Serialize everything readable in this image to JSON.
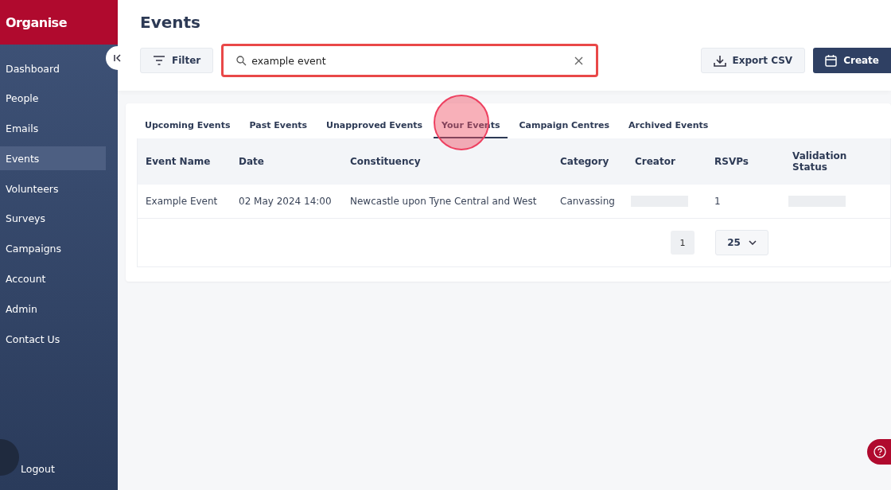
{
  "brand": "Organise",
  "sidebar": {
    "items": [
      {
        "label": "Dashboard",
        "selected": false
      },
      {
        "label": "People",
        "selected": false
      },
      {
        "label": "Emails",
        "selected": false
      },
      {
        "label": "Events",
        "selected": true
      },
      {
        "label": "Volunteers",
        "selected": false
      },
      {
        "label": "Surveys",
        "selected": false
      },
      {
        "label": "Campaigns",
        "selected": false
      },
      {
        "label": "Account",
        "selected": false
      },
      {
        "label": "Admin",
        "selected": false
      },
      {
        "label": "Contact Us",
        "selected": false
      }
    ],
    "logout": "Logout"
  },
  "page_title": "Events",
  "toolbar": {
    "filter": "Filter",
    "search": {
      "value": "example event"
    },
    "export": "Export CSV",
    "create": "Create"
  },
  "tabs": [
    {
      "label": "Upcoming Events",
      "selected": false
    },
    {
      "label": "Past Events",
      "selected": false
    },
    {
      "label": "Unapproved Events",
      "selected": false
    },
    {
      "label": "Your Events",
      "selected": true
    },
    {
      "label": "Campaign Centres",
      "selected": false
    },
    {
      "label": "Archived Events",
      "selected": false
    }
  ],
  "table": {
    "columns": [
      "Event Name",
      "Date",
      "Constituency",
      "Category",
      "Creator",
      "RSVPs",
      "Validation Status"
    ],
    "rows": [
      {
        "cells": [
          "Example Event",
          "02 May 2024 14:00",
          "Newcastle upon Tyne Central and West",
          "Canvassing",
          null,
          "1",
          null
        ]
      }
    ]
  },
  "pagination": {
    "page": "1",
    "page_size": "25"
  }
}
